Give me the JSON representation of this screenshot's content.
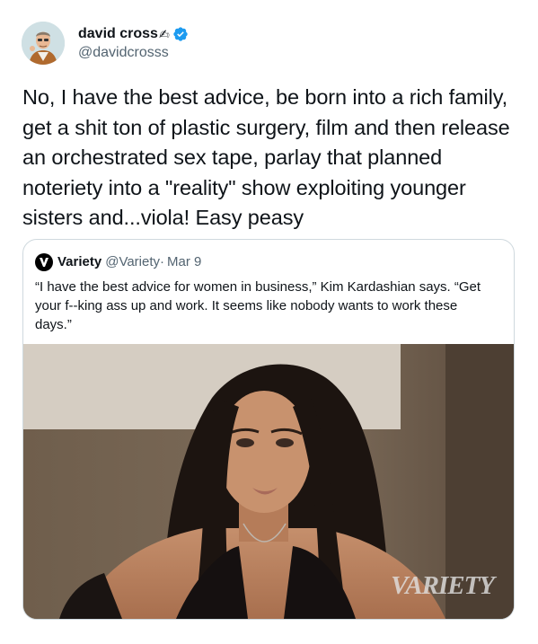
{
  "author": {
    "name": "david cross",
    "name_emoji": "✍",
    "handle": "@davidcrosss",
    "avatar_icon": "user-avatar",
    "verified_icon": "verified-badge-icon"
  },
  "tweet": {
    "text": "No, I have the best advice, be born into a rich family, get a shit ton of plastic surgery, film and then release an orchestrated sex tape, parlay that planned noteriety into a \"reality\" show exploiting younger sisters and...viola!  Easy peasy"
  },
  "quoted_tweet": {
    "name": "Variety",
    "handle": "@Variety",
    "separator": "·",
    "date": "Mar 9",
    "text": "“I have the best advice for women in business,” Kim Kardashian says. “Get your f--king ass up and work. It seems like nobody wants to work these days.”",
    "logo_icon": "variety-logo-icon",
    "image_watermark": "VARIETY"
  },
  "colors": {
    "text_primary": "#0f1419",
    "text_secondary": "#536471",
    "border": "#cfd9de",
    "verified_blue": "#1d9bf0"
  }
}
